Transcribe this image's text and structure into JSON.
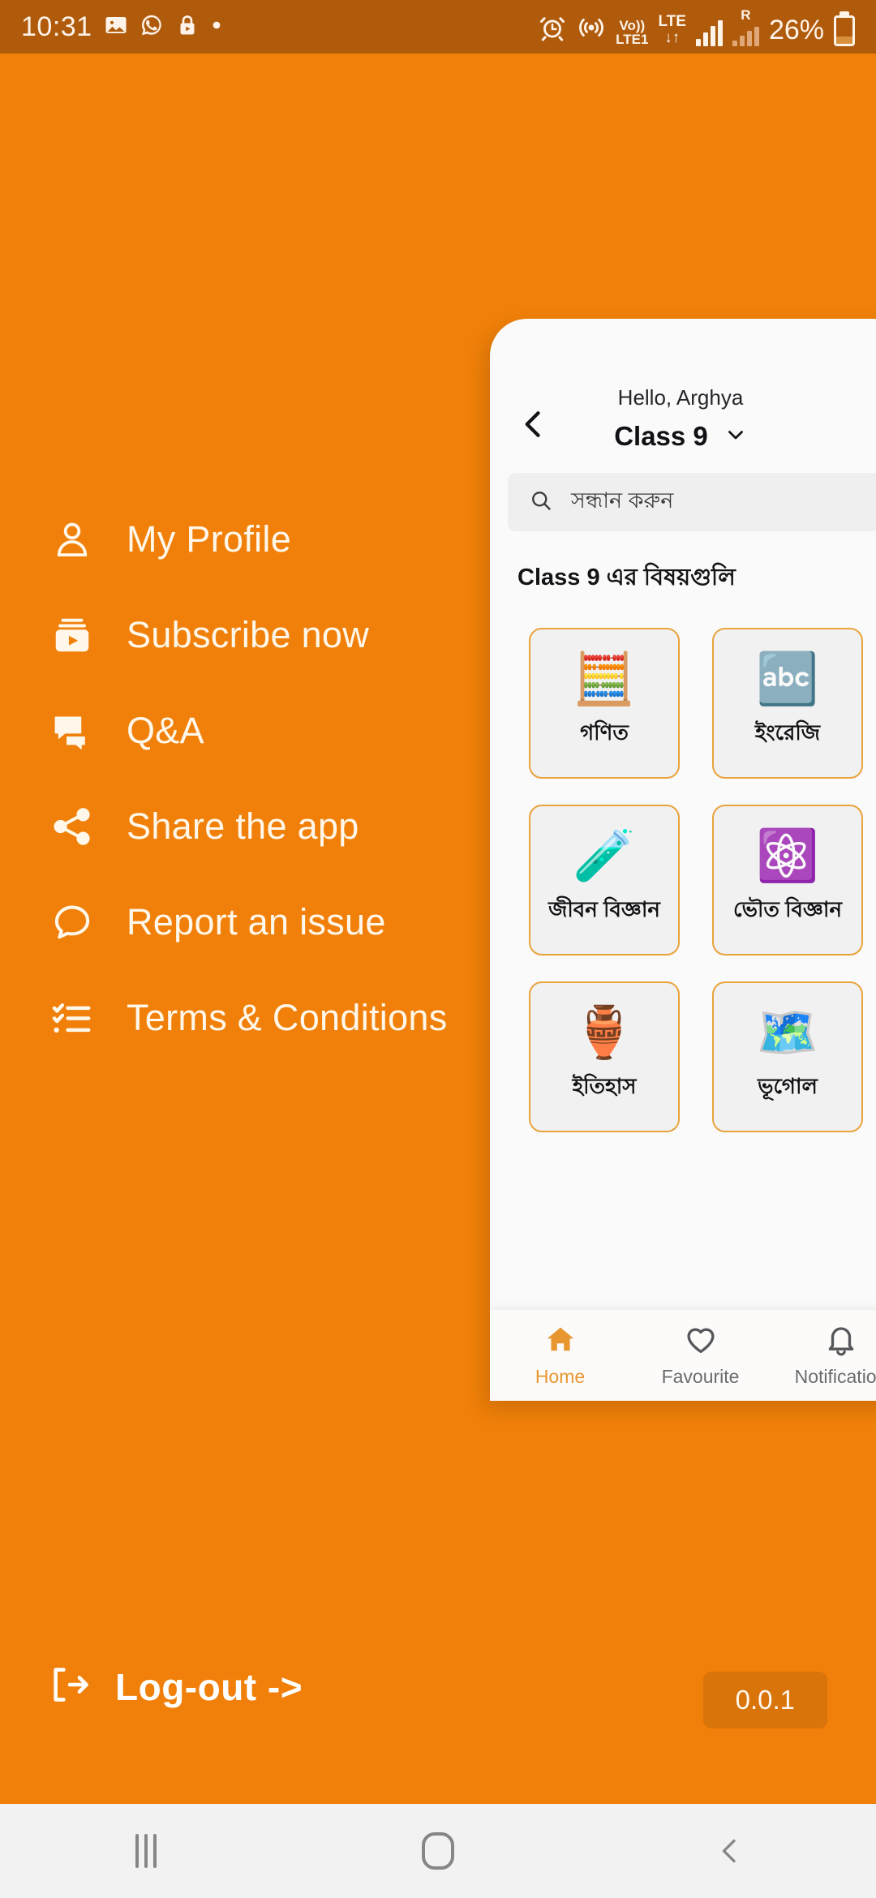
{
  "status_bar": {
    "time": "10:31",
    "left_icons": [
      "photo-icon",
      "whatsapp-icon",
      "lock-play-icon",
      "dot-icon"
    ],
    "right_icons": [
      "alarm-icon",
      "hotspot-icon"
    ],
    "volte_line1": "Vo))",
    "volte_line2": "LTE1",
    "lte_line1": "LTE",
    "lte_line2": "↓↑",
    "roaming_label": "R",
    "battery_percent": "26%",
    "battery_level": 26,
    "background": "#B05A0B",
    "foreground": "#FDF3E8"
  },
  "drawer": {
    "background": "#F08009",
    "items": [
      {
        "label": "My Profile",
        "icon": "user-icon"
      },
      {
        "label": "Subscribe now",
        "icon": "subscribe-icon"
      },
      {
        "label": "Q&A",
        "icon": "chat-bubbles-icon"
      },
      {
        "label": "Share the app",
        "icon": "share-icon"
      },
      {
        "label": "Report an issue",
        "icon": "comment-icon"
      },
      {
        "label": "Terms & Conditions",
        "icon": "checklist-icon"
      }
    ],
    "logout_label": "Log-out ->",
    "logout_icon": "exit-icon",
    "version": "0.0.1",
    "version_badge_color": "#D9740A"
  },
  "app_panel": {
    "back_icon": "chevron-left-icon",
    "greeting": "Hello, Arghya",
    "class_name": "Class 9",
    "class_dropdown_icon": "chevron-down-icon",
    "search": {
      "icon": "search-icon",
      "placeholder": "সন্ধান করুন",
      "value": ""
    },
    "subjects_title": "Class 9  এর বিষয়গুলি",
    "card_border_color": "#E9A33C",
    "subjects": [
      {
        "label": "গণিত",
        "emoji": "🧮",
        "icon": "calculator-ruler-icon"
      },
      {
        "label": "ইংরেজি",
        "emoji": "🔤",
        "icon": "abc-board-icon"
      },
      {
        "label": "জীবন বিজ্ঞান",
        "emoji": "🧪",
        "icon": "flask-leaf-icon"
      },
      {
        "label": "ভৌত বিজ্ঞান",
        "emoji": "⚛️",
        "icon": "atom-board-icon"
      },
      {
        "label": "ইতিহাস",
        "emoji": "🏺",
        "icon": "artifacts-icon"
      },
      {
        "label": "ভূগোল",
        "emoji": "🗺️",
        "icon": "globe-map-icon"
      }
    ],
    "bottom_nav": {
      "active": "Home",
      "items": [
        {
          "label": "Home",
          "icon": "home-icon"
        },
        {
          "label": "Favourite",
          "icon": "heart-icon"
        },
        {
          "label": "Notification",
          "icon": "bell-icon"
        }
      ],
      "active_color": "#E8962F"
    }
  },
  "android_nav": {
    "recents_label": "recents-icon",
    "home_label": "home-icon",
    "back_label": "back-icon"
  }
}
